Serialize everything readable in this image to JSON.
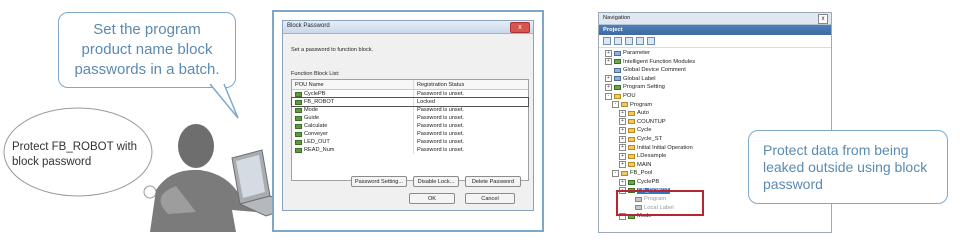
{
  "callouts": {
    "top": "Set the program product name block passwords in a batch.",
    "right": "Protect data from being leaked outside using block password"
  },
  "thought": {
    "text": "Protect FB_ROBOT with block password"
  },
  "dialog": {
    "title": "Block Password",
    "close_label": "x",
    "instruction": "Set a password to function block.",
    "list_label": "Function Block List:",
    "columns": [
      "POU Name",
      "Registration Status"
    ],
    "rows": [
      {
        "name": "CyclePB",
        "status": "Password is unset."
      },
      {
        "name": "FB_ROBOT",
        "status": "Locked"
      },
      {
        "name": "Mode",
        "status": "Password is unset."
      },
      {
        "name": "Guide",
        "status": "Password is unset."
      },
      {
        "name": "Calculate",
        "status": "Password is unset."
      },
      {
        "name": "Conveyer",
        "status": "Password is unset."
      },
      {
        "name": "LED_OUT",
        "status": "Password is unset."
      },
      {
        "name": "READ_Num",
        "status": "Password is unset."
      }
    ],
    "selected_index": 1,
    "buttons": {
      "setting": "Password Setting...",
      "disable": "Disable Lock...",
      "delete": "Delete Password",
      "ok": "OK",
      "cancel": "Cancel"
    }
  },
  "navigation": {
    "title": "Navigation",
    "close_label": "x",
    "tab": "Project",
    "tree": [
      {
        "label": "Parameter",
        "level": 0,
        "toggle": "+",
        "icon": "blue"
      },
      {
        "label": "Intelligent Function Modules",
        "level": 0,
        "toggle": "+",
        "icon": "green"
      },
      {
        "label": "Global Device Comment",
        "level": 0,
        "toggle": "",
        "icon": "blue"
      },
      {
        "label": "Global Label",
        "level": 0,
        "toggle": "+",
        "icon": "blue"
      },
      {
        "label": "Program Setting",
        "level": 0,
        "toggle": "+",
        "icon": "green"
      },
      {
        "label": "POU",
        "level": 0,
        "toggle": "-",
        "icon": "folder"
      },
      {
        "label": "Program",
        "level": 1,
        "toggle": "-",
        "icon": "folder"
      },
      {
        "label": "Auto",
        "level": 2,
        "toggle": "+",
        "icon": "folder"
      },
      {
        "label": "COUNTUP",
        "level": 2,
        "toggle": "+",
        "icon": "folder"
      },
      {
        "label": "Cycle",
        "level": 2,
        "toggle": "+",
        "icon": "folder"
      },
      {
        "label": "Cycle_ST",
        "level": 2,
        "toggle": "+",
        "icon": "folder"
      },
      {
        "label": "Initial Initial Operation",
        "level": 2,
        "toggle": "+",
        "icon": "folder"
      },
      {
        "label": "LDexample",
        "level": 2,
        "toggle": "+",
        "icon": "folder"
      },
      {
        "label": "MAIN",
        "level": 2,
        "toggle": "+",
        "icon": "folder"
      },
      {
        "label": "FB_Pool",
        "level": 1,
        "toggle": "-",
        "icon": "folder"
      },
      {
        "label": "CyclePB",
        "level": 2,
        "toggle": "+",
        "icon": "green"
      },
      {
        "label": "FB_ROBOT",
        "level": 2,
        "toggle": "-",
        "icon": "green",
        "selected": true
      },
      {
        "label": "Program",
        "level": 3,
        "toggle": "",
        "icon": "gray",
        "dim": true
      },
      {
        "label": "Local Label",
        "level": 3,
        "toggle": "",
        "icon": "gray",
        "dim": true
      },
      {
        "label": "Mode",
        "level": 2,
        "toggle": "+",
        "icon": "green"
      }
    ]
  },
  "colors": {
    "callout_text": "#5a8ab2",
    "callout_border": "#7fa9c9",
    "highlight": "#b32633",
    "tree_selection": "#3874c4"
  }
}
